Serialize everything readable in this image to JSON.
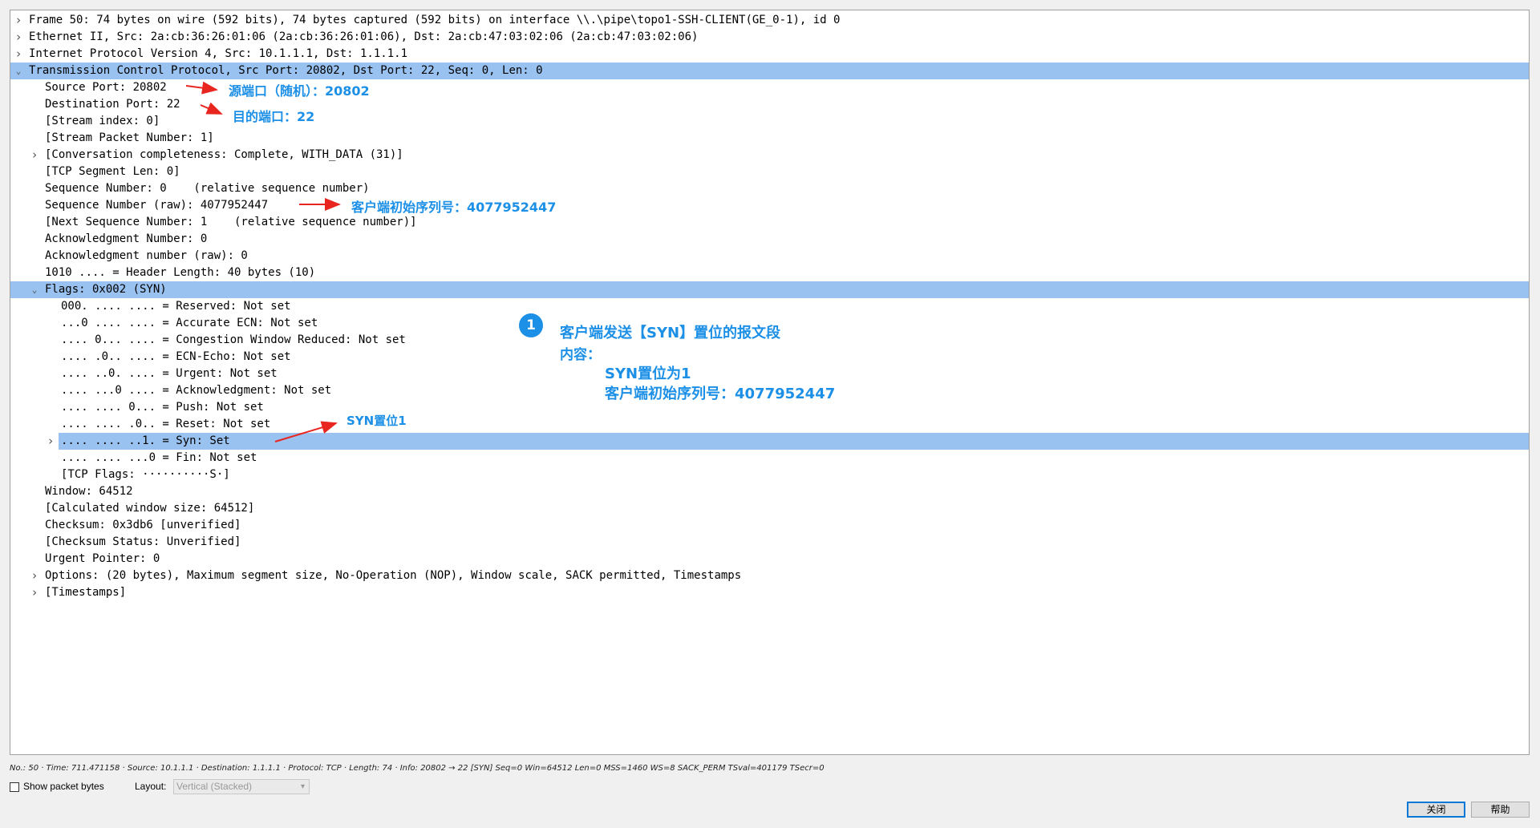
{
  "tree": [
    {
      "text": "Frame 50: 74 bytes on wire (592 bits), 74 bytes captured (592 bits) on interface \\\\.\\pipe\\topo1-SSH-CLIENT(GE_0-1), id 0",
      "indent": 0,
      "expander": "collapsed",
      "selected": false
    },
    {
      "text": "Ethernet II, Src: 2a:cb:36:26:01:06 (2a:cb:36:26:01:06), Dst: 2a:cb:47:03:02:06 (2a:cb:47:03:02:06)",
      "indent": 0,
      "expander": "collapsed",
      "selected": false
    },
    {
      "text": "Internet Protocol Version 4, Src: 10.1.1.1, Dst: 1.1.1.1",
      "indent": 0,
      "expander": "collapsed",
      "selected": false
    },
    {
      "text": "Transmission Control Protocol, Src Port: 20802, Dst Port: 22, Seq: 0, Len: 0",
      "indent": 0,
      "expander": "expanded",
      "selected": true
    },
    {
      "text": "Source Port: 20802",
      "indent": 1,
      "expander": "none",
      "selected": false
    },
    {
      "text": "Destination Port: 22",
      "indent": 1,
      "expander": "none",
      "selected": false
    },
    {
      "text": "[Stream index: 0]",
      "indent": 1,
      "expander": "none",
      "selected": false
    },
    {
      "text": "[Stream Packet Number: 1]",
      "indent": 1,
      "expander": "none",
      "selected": false
    },
    {
      "text": "[Conversation completeness: Complete, WITH_DATA (31)]",
      "indent": 1,
      "expander": "collapsed",
      "selected": false
    },
    {
      "text": "[TCP Segment Len: 0]",
      "indent": 1,
      "expander": "none",
      "selected": false
    },
    {
      "text": "Sequence Number: 0    (relative sequence number)",
      "indent": 1,
      "expander": "none",
      "selected": false
    },
    {
      "text": "Sequence Number (raw): 4077952447",
      "indent": 1,
      "expander": "none",
      "selected": false
    },
    {
      "text": "[Next Sequence Number: 1    (relative sequence number)]",
      "indent": 1,
      "expander": "none",
      "selected": false
    },
    {
      "text": "Acknowledgment Number: 0",
      "indent": 1,
      "expander": "none",
      "selected": false
    },
    {
      "text": "Acknowledgment number (raw): 0",
      "indent": 1,
      "expander": "none",
      "selected": false
    },
    {
      "text": "1010 .... = Header Length: 40 bytes (10)",
      "indent": 1,
      "expander": "none",
      "selected": false
    },
    {
      "text": "Flags: 0x002 (SYN)",
      "indent": 1,
      "expander": "expanded",
      "selected": true
    },
    {
      "text": "000. .... .... = Reserved: Not set",
      "indent": 2,
      "expander": "none",
      "selected": false
    },
    {
      "text": "...0 .... .... = Accurate ECN: Not set",
      "indent": 2,
      "expander": "none",
      "selected": false
    },
    {
      "text": ".... 0... .... = Congestion Window Reduced: Not set",
      "indent": 2,
      "expander": "none",
      "selected": false
    },
    {
      "text": ".... .0.. .... = ECN-Echo: Not set",
      "indent": 2,
      "expander": "none",
      "selected": false
    },
    {
      "text": ".... ..0. .... = Urgent: Not set",
      "indent": 2,
      "expander": "none",
      "selected": false
    },
    {
      "text": ".... ...0 .... = Acknowledgment: Not set",
      "indent": 2,
      "expander": "none",
      "selected": false
    },
    {
      "text": ".... .... 0... = Push: Not set",
      "indent": 2,
      "expander": "none",
      "selected": false
    },
    {
      "text": ".... .... .0.. = Reset: Not set",
      "indent": 2,
      "expander": "none",
      "selected": false
    },
    {
      "text": ".... .... ..1. = Syn: Set",
      "indent": 2,
      "expander": "collapsed",
      "selected": true
    },
    {
      "text": ".... .... ...0 = Fin: Not set",
      "indent": 2,
      "expander": "none",
      "selected": false
    },
    {
      "text": "[TCP Flags: ··········S·]",
      "indent": 2,
      "expander": "none",
      "selected": false
    },
    {
      "text": "Window: 64512",
      "indent": 1,
      "expander": "none",
      "selected": false
    },
    {
      "text": "[Calculated window size: 64512]",
      "indent": 1,
      "expander": "none",
      "selected": false
    },
    {
      "text": "Checksum: 0x3db6 [unverified]",
      "indent": 1,
      "expander": "none",
      "selected": false
    },
    {
      "text": "[Checksum Status: Unverified]",
      "indent": 1,
      "expander": "none",
      "selected": false
    },
    {
      "text": "Urgent Pointer: 0",
      "indent": 1,
      "expander": "none",
      "selected": false
    },
    {
      "text": "Options: (20 bytes), Maximum segment size, No-Operation (NOP), Window scale, SACK permitted, Timestamps",
      "indent": 1,
      "expander": "collapsed",
      "selected": false
    },
    {
      "text": "[Timestamps]",
      "indent": 1,
      "expander": "collapsed",
      "selected": false
    }
  ],
  "annotations": {
    "src_port": "源端口（随机）：20802",
    "dst_port": "目的端口：22",
    "isn": "客户端初始序列号：4077952447",
    "badge": "1",
    "summary_title": "客户端发送【SYN】置位的报文段",
    "summary_content_label": "内容：",
    "summary_syn": "SYN置位为1",
    "summary_isn": "客户端初始序列号：4077952447",
    "syn_label": "SYN置位1",
    "color": "#1c8fe6",
    "arrow_color": "#e8261f"
  },
  "status_line": "No.: 50 · Time: 711.471158 · Source: 10.1.1.1 · Destination: 1.1.1.1 · Protocol: TCP · Length: 74 · Info: 20802 → 22 [SYN] Seq=0 Win=64512 Len=0 MSS=1460 WS=8 SACK_PERM TSval=401179 TSecr=0",
  "bottom": {
    "show_packet_bytes_label": "Show packet bytes",
    "show_packet_bytes_checked": false,
    "layout_label": "Layout:",
    "layout_value": "Vertical (Stacked)",
    "close_button": "关闭",
    "help_button": "帮助"
  },
  "colors": {
    "selection": "#99c2f0",
    "pane_background": "#ffffff",
    "window_background": "#f0f0f0"
  }
}
